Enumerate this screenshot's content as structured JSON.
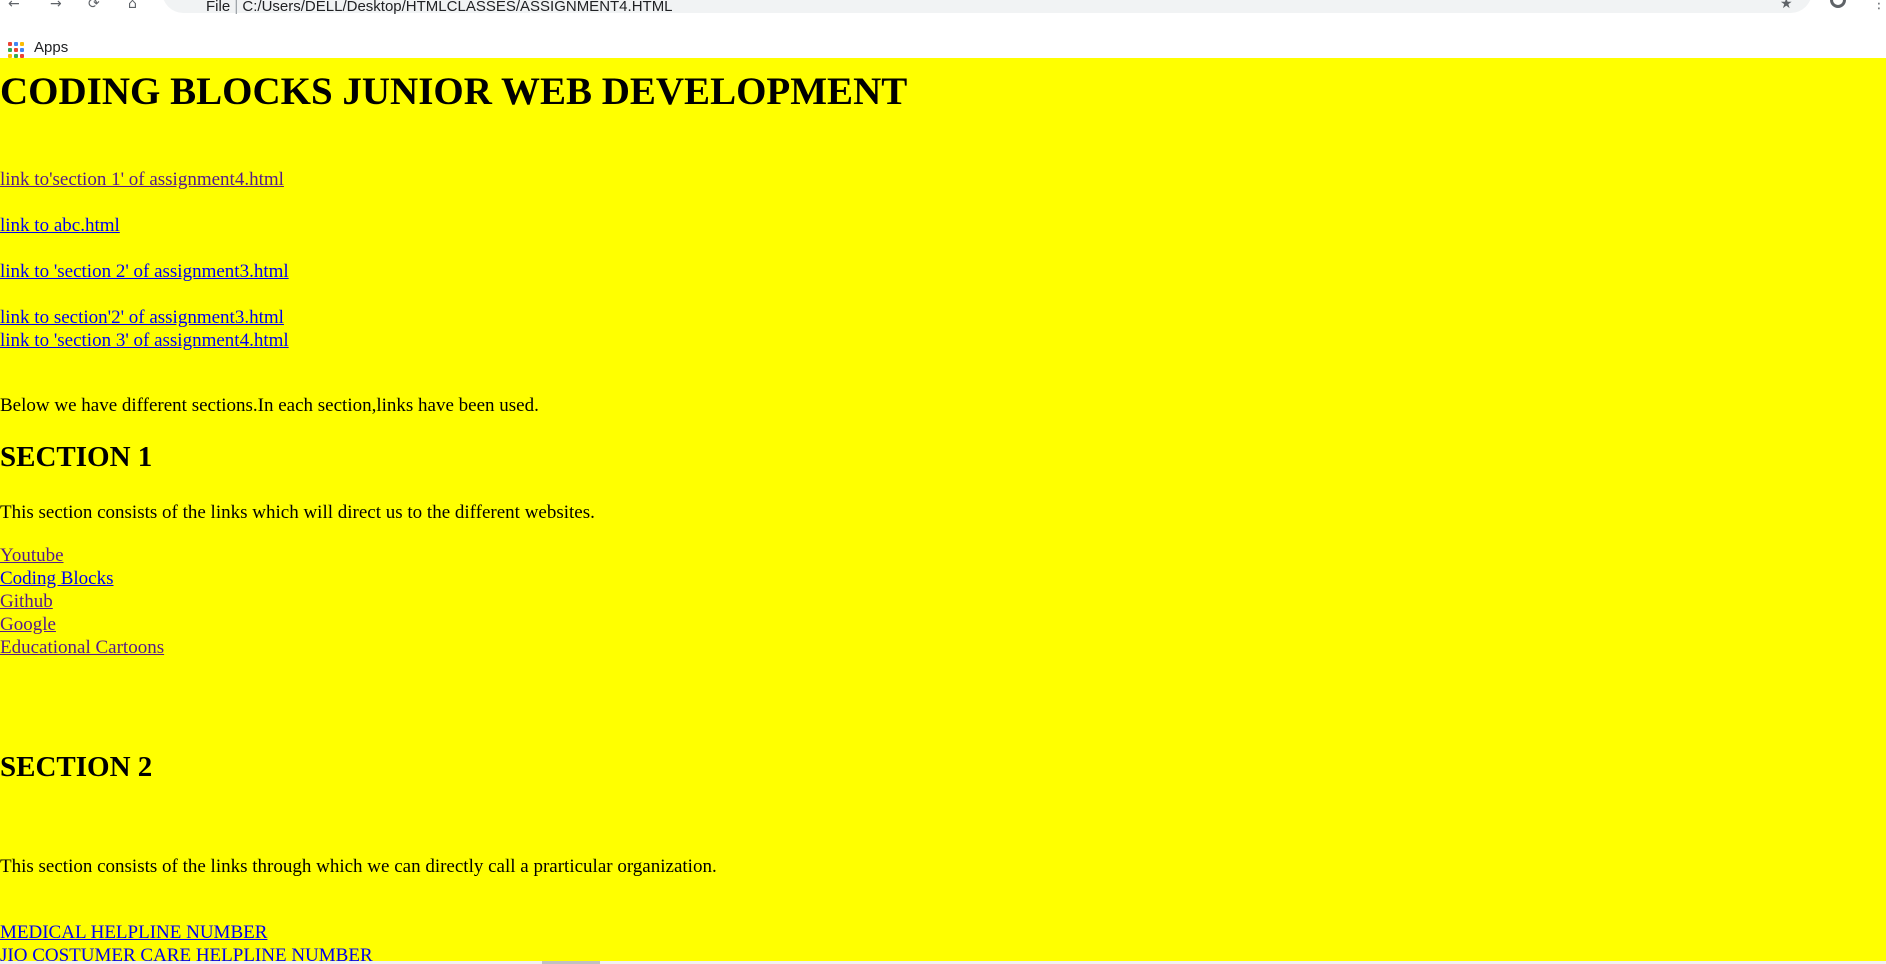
{
  "browser": {
    "address_prefix": "File",
    "address_path": "C:/Users/DELL/Desktop/HTMLCLASSES/ASSIGNMENT4.HTML",
    "bookmarks_apps_label": "Apps",
    "apps_icon_colors": [
      "#ea4335",
      "#4285f4",
      "#fbbc05",
      "#34a853",
      "#ea4335",
      "#4285f4",
      "#fbbc05",
      "#34a853",
      "#ea4335"
    ]
  },
  "page": {
    "background": "#ffff00",
    "title": "CODING BLOCKS JUNIOR WEB DEVELOPMENT",
    "top_links": [
      "link to'section 1' of assignment4.html",
      "link to abc.html",
      "link to 'section 2' of assignment3.html",
      "link to section'2' of assignment3.html",
      "link to 'section 3' of assignment4.html"
    ],
    "intro": "Below we have different sections.In each section,links have been used.",
    "section1": {
      "heading": "SECTION 1",
      "description": "This section consists of the links which will direct us to the different websites.",
      "links": [
        "Youtube",
        "Coding Blocks",
        "Github",
        "Google",
        "Educational Cartoons"
      ]
    },
    "section2": {
      "heading": "SECTION 2",
      "description": "This section consists of the links through which we can directly call a prarticular organization.",
      "links": [
        "MEDICAL HELPLINE NUMBER",
        "JIO COSTUMER CARE HELPLINE NUMBER"
      ]
    }
  }
}
